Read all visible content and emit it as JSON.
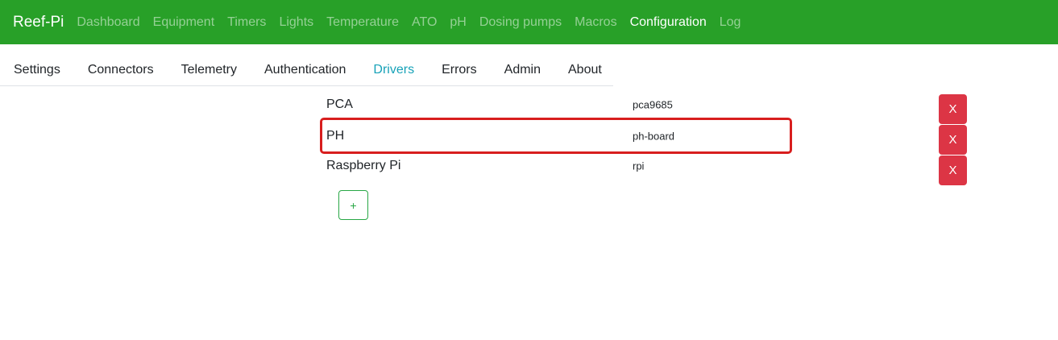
{
  "navbar": {
    "brand": "Reef-Pi",
    "links": [
      "Dashboard",
      "Equipment",
      "Timers",
      "Lights",
      "Temperature",
      "ATO",
      "pH",
      "Dosing pumps",
      "Macros",
      "Configuration",
      "Log"
    ],
    "active": "Configuration"
  },
  "tabs": {
    "items": [
      "Settings",
      "Connectors",
      "Telemetry",
      "Authentication",
      "Drivers",
      "Errors",
      "Admin",
      "About"
    ],
    "active": "Drivers"
  },
  "drivers": [
    {
      "name": "PCA",
      "type": "pca9685",
      "delete_label": "X"
    },
    {
      "name": "PH",
      "type": "ph-board",
      "delete_label": "X"
    },
    {
      "name": "Raspberry Pi",
      "type": "rpi",
      "delete_label": "X"
    }
  ],
  "add_label": "+",
  "colors": {
    "navbar_bg": "#28a028",
    "active_tab": "#17a2b8",
    "delete": "#dc3545",
    "add": "#28a745",
    "highlight": "#d81e1e"
  }
}
